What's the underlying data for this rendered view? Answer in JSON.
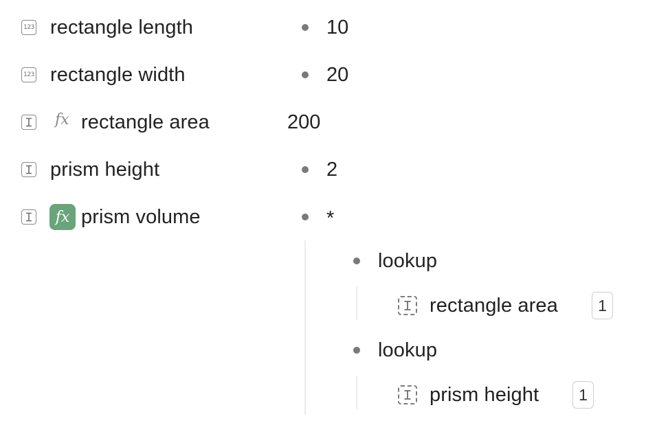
{
  "fields": [
    {
      "label": "rectangle length",
      "type_icon": "number-123-icon",
      "value": "10"
    },
    {
      "label": "rectangle width",
      "type_icon": "number-123-icon",
      "value": "20"
    },
    {
      "label": "rectangle area",
      "type_icon": "text-field-icon",
      "formula_icon": "fx-icon",
      "value": "200"
    },
    {
      "label": "prism height",
      "type_icon": "text-field-icon",
      "value": "2"
    },
    {
      "label": "prism volume",
      "type_icon": "text-field-icon",
      "formula_icon": "fx-badge-icon",
      "value": "*"
    }
  ],
  "type_icon_text": "123",
  "formula_icon_text": "fx",
  "formula_tree": {
    "operator": "*",
    "children": [
      {
        "label": "lookup",
        "ref": {
          "label": "rectangle area",
          "icon": "text-field-dashed-icon",
          "count": "1"
        }
      },
      {
        "label": "lookup",
        "ref": {
          "label": "prism height",
          "icon": "text-field-dashed-icon",
          "count": "1"
        }
      }
    ]
  },
  "colors": {
    "formula_badge": "#6aa47a",
    "text": "#222222",
    "icon": "#8a8a8a",
    "bullet": "#7a7a7a"
  }
}
